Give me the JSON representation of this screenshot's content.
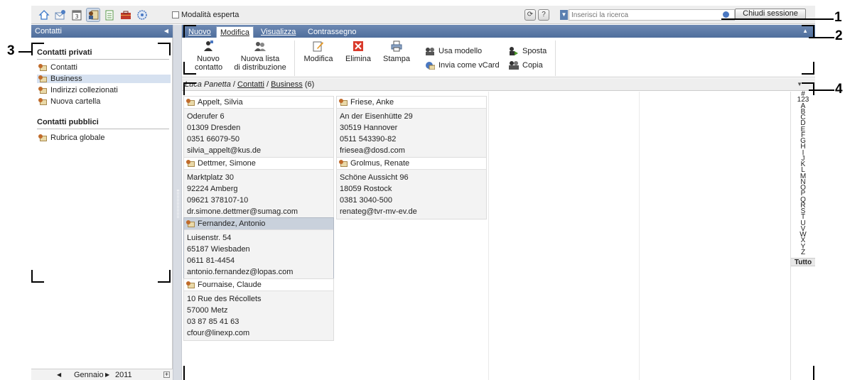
{
  "toolbar": {
    "apps": [
      "home-icon",
      "mail-icon",
      "calendar-icon",
      "contacts-icon",
      "tasks-icon",
      "portfolio-icon",
      "settings-icon"
    ],
    "expert_mode_label": "Modalità esperta",
    "search_placeholder": "Inserisci la ricerca",
    "logout_label": "Chiudi sessione"
  },
  "left": {
    "header": "Contatti",
    "private_title": "Contatti privati",
    "private_items": [
      "Contatti",
      "Business",
      "Indirizzi collezionati",
      "Nuova cartella"
    ],
    "selected_index": 1,
    "public_title": "Contatti pubblici",
    "public_items": [
      "Rubrica globale"
    ],
    "calendar": {
      "month": "Gennaio",
      "year": "2011"
    }
  },
  "tabs": [
    "Nuovo",
    "Modifica",
    "Visualizza",
    "Contrassegno"
  ],
  "active_tab": 1,
  "ribbon": {
    "new_contact_1": "Nuovo",
    "new_contact_2": "contatto",
    "new_list_1": "Nuova lista",
    "new_list_2": "di distribuzione",
    "edit": "Modifica",
    "delete": "Elimina",
    "print": "Stampa",
    "use_template": "Usa modello",
    "send_vcard": "Invia come vCard",
    "move": "Sposta",
    "copy": "Copia"
  },
  "breadcrumb": {
    "user": "Luca Panetta",
    "folder": "Contatti",
    "sub": "Business",
    "count": "(6)"
  },
  "contacts": [
    {
      "name": "Appelt, Silvia",
      "street": "Oderufer 6",
      "city": "01309 Dresden",
      "phone": "0351 66079-50",
      "email": "silvia_appelt@kus.de"
    },
    {
      "name": "Friese, Anke",
      "street": "An der Eisenhütte 29",
      "city": "30519 Hannover",
      "phone": "0511 543390-82",
      "email": "friesea@dosd.com"
    },
    {
      "name": "Dettmer, Simone",
      "street": "Marktplatz 30",
      "city": "92224 Amberg",
      "phone": "09621 378107-10",
      "email": "dr.simone.dettmer@sumag.com"
    },
    {
      "name": "Grolmus, Renate",
      "street": "Schöne Aussicht 96",
      "city": "18059 Rostock",
      "phone": "0381 3040-500",
      "email": "renateg@tvr-mv-ev.de"
    },
    {
      "name": "Fernandez, Antonio",
      "street": "Luisenstr. 54",
      "city": "65187 Wiesbaden",
      "phone": "0611 81-4454",
      "email": "antonio.fernandez@lopas.com"
    },
    {
      "name": "Fournaise, Claude",
      "street": "10 Rue des Récollets",
      "city": "57000 Metz",
      "phone": "03 87 85 41 63",
      "email": "cfour@linexp.com"
    }
  ],
  "selected_contact": 4,
  "alpha": [
    "#",
    "123",
    "A",
    "B",
    "C",
    "D",
    "E",
    "F",
    "G",
    "H",
    "I",
    "J",
    "K",
    "L",
    "M",
    "N",
    "O",
    "P",
    "Q",
    "R",
    "S",
    "T",
    "U",
    "V",
    "W",
    "X",
    "Y",
    "Z"
  ],
  "alpha_all": "Tutto",
  "callouts": [
    "1",
    "2",
    "3",
    "4"
  ]
}
